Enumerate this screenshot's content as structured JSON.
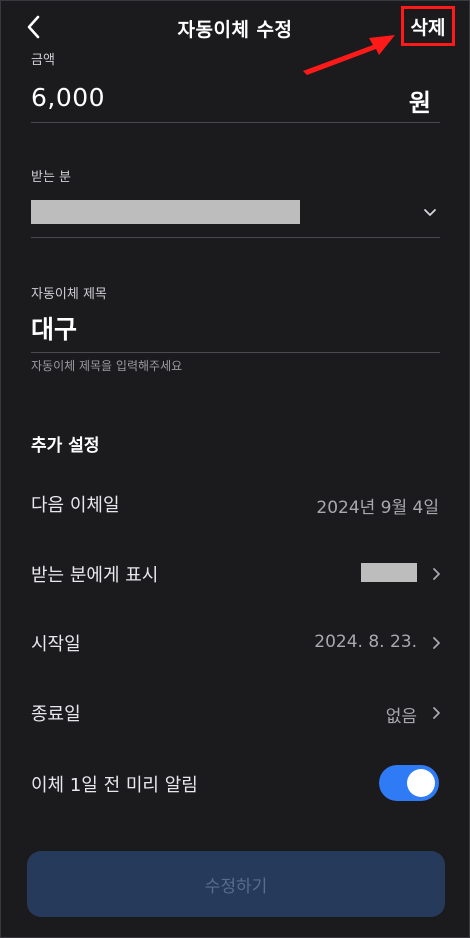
{
  "header": {
    "title": "자동이체 수정",
    "delete_label": "삭제"
  },
  "amount": {
    "label": "금액",
    "value": "6,000",
    "unit": "원"
  },
  "recipient": {
    "label": "받는 분"
  },
  "transfer_title": {
    "label": "자동이체 제목",
    "value": "대구",
    "helper": "자동이체 제목을 입력해주세요"
  },
  "extra_settings": {
    "title": "추가 설정",
    "next_transfer": {
      "label": "다음 이체일",
      "value": "2024년 9월 4일"
    },
    "display_to_recipient": {
      "label": "받는 분에게 표시"
    },
    "start_date": {
      "label": "시작일",
      "value": "2024. 8. 23."
    },
    "end_date": {
      "label": "종료일",
      "value": "없음"
    },
    "reminder": {
      "label": "이체 1일 전 미리 알림",
      "enabled": true
    }
  },
  "submit": {
    "label": "수정하기"
  },
  "colors": {
    "background": "#1b1b1e",
    "accent": "#2f7bf6",
    "annotation": "#ff1a1a",
    "button_disabled": "#263a5c"
  }
}
